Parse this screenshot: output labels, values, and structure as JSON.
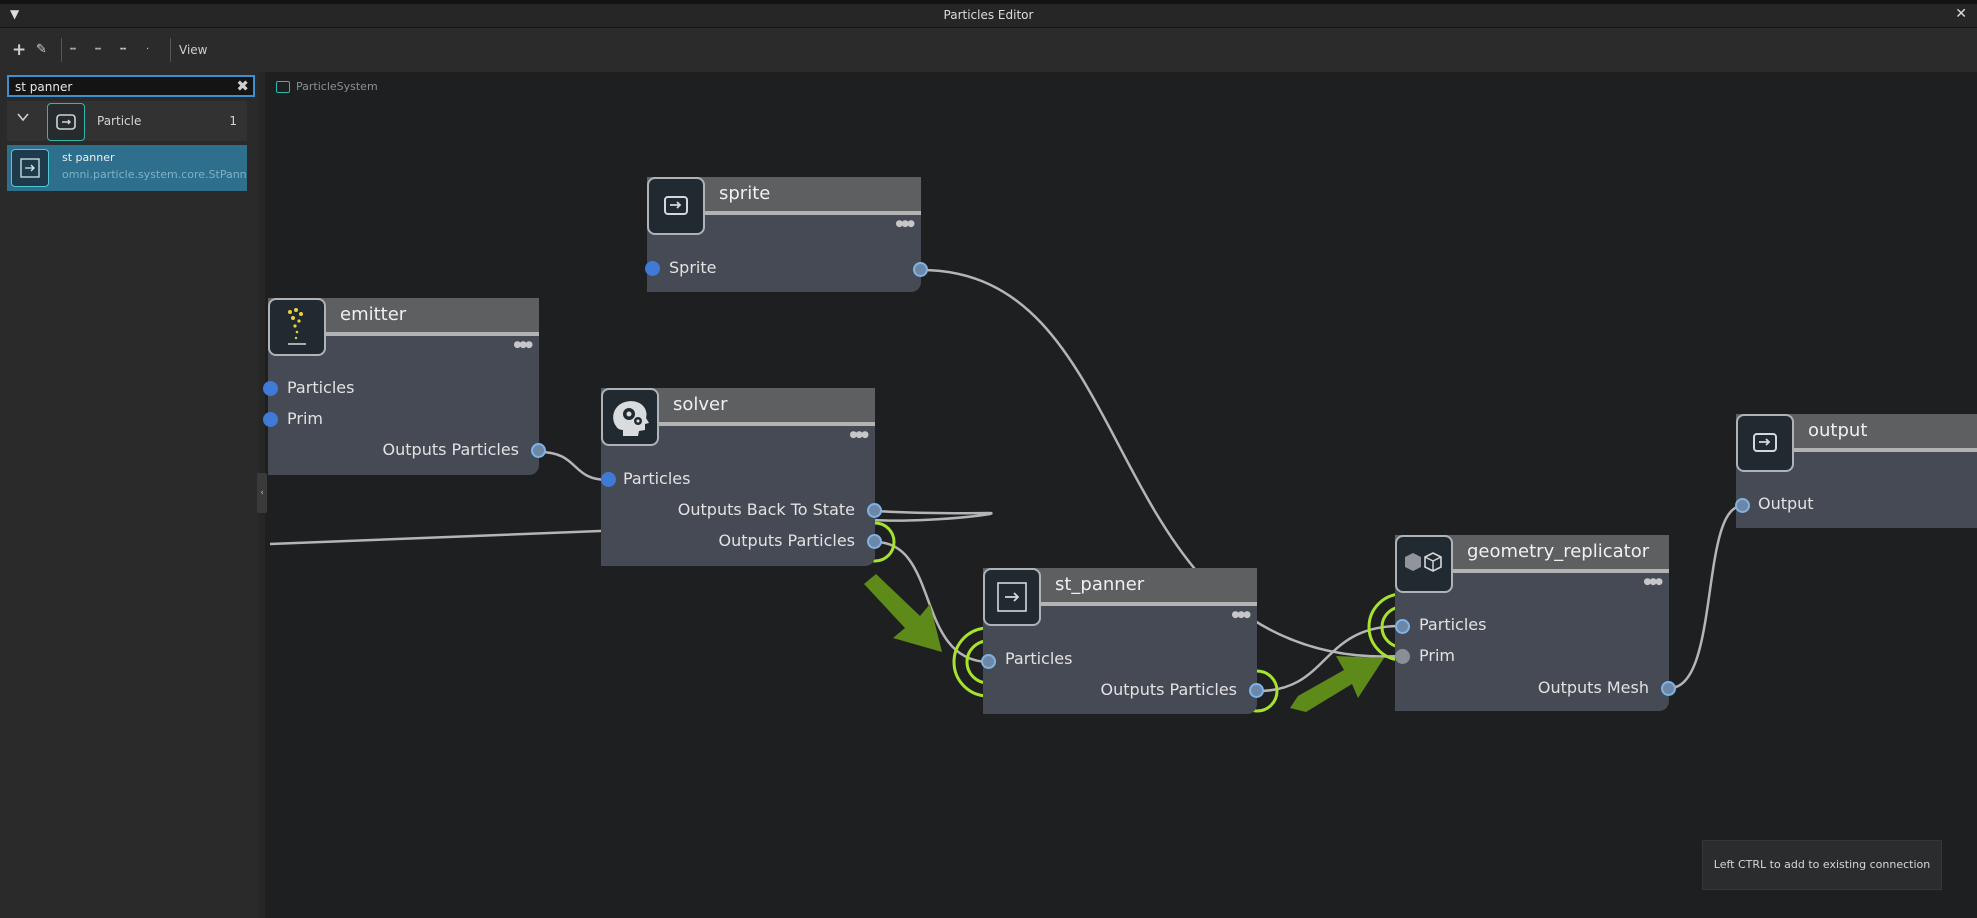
{
  "window": {
    "title": "Particles Editor"
  },
  "toolbar": {
    "view_label": "View"
  },
  "sidebar": {
    "search": {
      "value": "st panner"
    },
    "category": {
      "label": "Particle",
      "count": "1"
    },
    "result": {
      "name": "st panner",
      "path": "omni.particle.system.core.StPanner"
    }
  },
  "breadcrumb": {
    "label": "ParticleSystem"
  },
  "nodes": {
    "sprite": {
      "title": "sprite",
      "ports": [
        "Sprite"
      ]
    },
    "emitter": {
      "title": "emitter",
      "ports": [
        "Particles",
        "Prim",
        "Outputs Particles"
      ]
    },
    "solver": {
      "title": "solver",
      "ports": [
        "Particles",
        "Outputs Back To State",
        "Outputs Particles"
      ]
    },
    "st_panner": {
      "title": "st_panner",
      "ports": [
        "Particles",
        "Outputs Particles"
      ]
    },
    "geometry_replicator": {
      "title": "geometry_replicator",
      "ports": [
        "Particles",
        "Prim",
        "Outputs Mesh"
      ]
    },
    "output": {
      "title": "output",
      "ports": [
        "Output"
      ]
    }
  },
  "tooltip": {
    "text": "Left CTRL to add to existing connection"
  },
  "colors": {
    "accent": "#3d8fd0",
    "highlight": "#a6e22e",
    "arrow": "#5e8a1a",
    "selection": "#2d6f8c"
  }
}
